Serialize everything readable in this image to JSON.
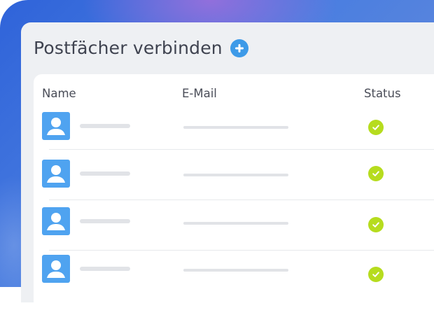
{
  "heading": {
    "title": "Postfächer verbinden",
    "add_icon": "plus-circle-icon",
    "add_color": "#3d9ae8"
  },
  "table": {
    "columns": [
      "Name",
      "E-Mail",
      "Status"
    ],
    "rows": [
      {
        "avatar_icon": "user-icon",
        "status": "connected",
        "status_icon": "check-circle-icon"
      },
      {
        "avatar_icon": "user-icon",
        "status": "connected",
        "status_icon": "check-circle-icon"
      },
      {
        "avatar_icon": "user-icon",
        "status": "connected",
        "status_icon": "check-circle-icon"
      },
      {
        "avatar_icon": "user-icon",
        "status": "connected",
        "status_icon": "check-circle-icon"
      }
    ]
  },
  "colors": {
    "avatar": "#4fa3f0",
    "status_ok": "#b6dc1e",
    "placeholder_bar": "#e1e3e7",
    "panel": "#eef0f3",
    "gradient_start": "#2f63d9",
    "gradient_end": "#6f8fd8"
  }
}
